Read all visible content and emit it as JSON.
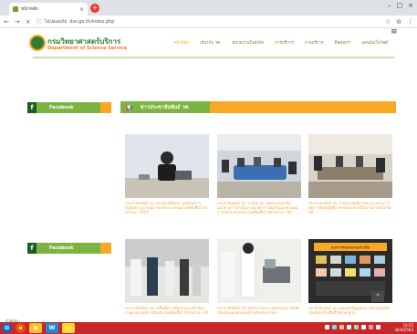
{
  "browser": {
    "tab_title": "หน้าหลัก",
    "tab_close": "×",
    "new_tab": "+",
    "url": "dss.go.th/index.php",
    "site_info": "ไม่ปลอดภัย",
    "controls": [
      "–",
      "□",
      "×"
    ],
    "nav": [
      "←",
      "→",
      "×"
    ],
    "right_icons": [
      "☆",
      "⊖",
      "⋮"
    ]
  },
  "site": {
    "name_th": "กรมวิทยาศาสตร์บริการ",
    "name_en": "Department of Science Service",
    "menu": [
      "หน้าหลัก",
      "เกี่ยวกับ วศ.",
      "หน่วยงานในสังกัด",
      "การบริการ",
      "งานบริการ",
      "ติดต่อเรา",
      "แผนผังเว็บไซต์"
    ],
    "hamburger": "≡"
  },
  "sidebar": {
    "facebook1": {
      "icon": "f",
      "label": "Facebook"
    },
    "facebook2": {
      "icon": "f",
      "label": "Facebook"
    }
  },
  "news": {
    "header_label": "ข่าวประชาสัมพันธ์ วศ.",
    "header_icon": "megaphone-icon",
    "items": [
      {
        "caption": "ประชาสัมพันธ์ วศ. ประชุมเตรียมความพร้อมการรับมือสถานการณ์การแพร่ระบาดของโรคติดเชื้อไวรัสโคโรนา 2019"
      },
      {
        "caption": "ประชาสัมพันธ์ วศ. ร่วมกับ อว. จัดประชุมหารือแนวทางการดำเนินงานมาตรการป้องกันและควบคุมการแพร่ระบาดของโรคติดเชื้อไวรัสโคโรนา 19"
      },
      {
        "caption": "ประชาสัมพันธ์ วศ. ร่วมประชุมพิจารณาแนวทางการจัดการห้องปฏิบัติการทดสอบภายใต้สถานการณ์โควิด 19"
      },
      {
        "caption": "ประชาสัมพันธ์ วศ. ลงพื้นที่ตรวจติดตามการดำเนินงานตามมาตรการป้องกันโรคติดเชื้อไวรัสโคโรนา 19"
      },
      {
        "caption": "ประชาสัมพันธ์ วศ. จัดกิจกรรมตรวจสอบคุณภาพผลิตภัณฑ์เจลแอลกอฮอล์สำหรับประชาชน"
      },
      {
        "caption": "ประชาสัมพันธ์ วศ. เผยแพร่ข้อมูลผลการทดสอบผลิตภัณฑ์เจลล้างมือที่ได้มาตรฐาน"
      }
    ],
    "card5_title": "ผลการทดสอบเจลล้างมือ",
    "scroll_top": "⌃"
  },
  "status_text": "กำลังรอ...",
  "clock": {
    "time": "10:25",
    "date": "30/4/2563"
  },
  "colors": {
    "brand_green": "#7cb342",
    "accent_orange": "#f9a825",
    "taskbar": "#c62828"
  }
}
